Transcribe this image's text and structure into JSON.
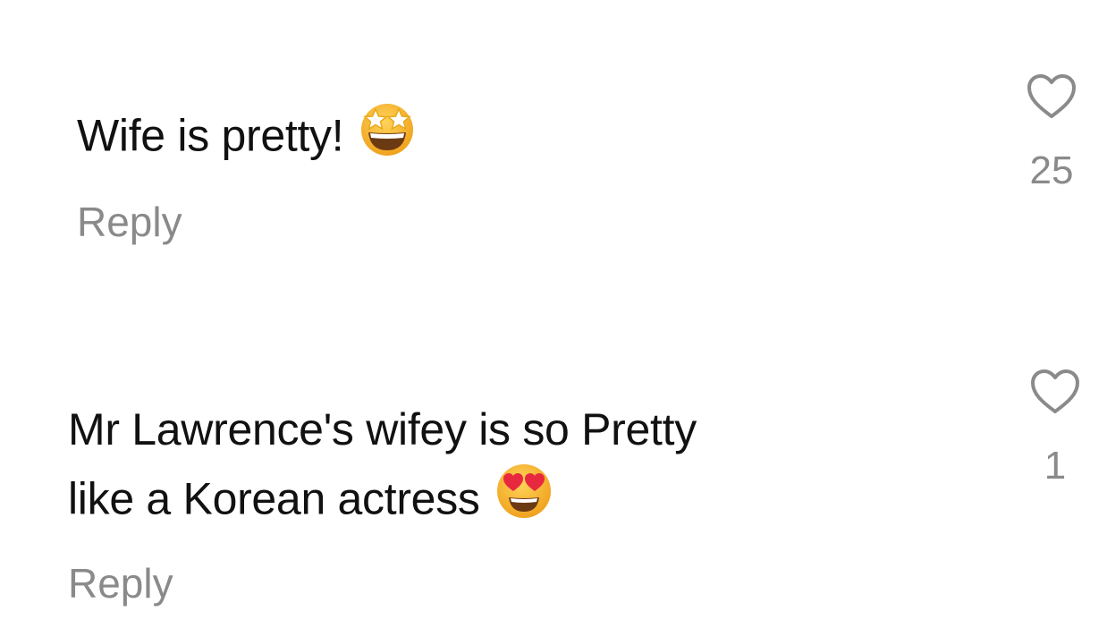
{
  "comments": [
    {
      "text": "Wife is pretty!",
      "emoji": "star-struck-emoji",
      "reply_label": "Reply",
      "like_count": "25",
      "heart_icon": "heart-outline-icon"
    },
    {
      "text_line_1": "Mr Lawrence's wifey  is so Pretty",
      "text_line_2": "like a Korean actress",
      "emoji": "heart-eyes-emoji",
      "reply_label": "Reply",
      "like_count": "1",
      "heart_icon": "heart-outline-icon"
    }
  ],
  "colors": {
    "text": "#111111",
    "muted": "#8a8a8a",
    "emoji_face": "#f6b52a",
    "heart_eyes": "#e8283f"
  }
}
